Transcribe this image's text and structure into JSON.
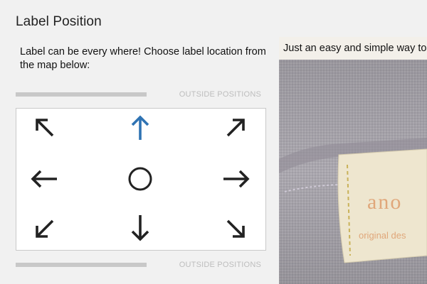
{
  "title": "Label Position",
  "description": "Label can be every where! Choose label location from the map below:",
  "outside_top": "OUTSIDE POSITIONS",
  "outside_bottom": "OUTSIDE POSITIONS",
  "positions": [
    {
      "name": "top-left",
      "icon": "arrow-up-left-icon",
      "selected": false
    },
    {
      "name": "top",
      "icon": "arrow-up-icon",
      "selected": true
    },
    {
      "name": "top-right",
      "icon": "arrow-up-right-icon",
      "selected": false
    },
    {
      "name": "left",
      "icon": "arrow-left-icon",
      "selected": false
    },
    {
      "name": "center",
      "icon": "circle-icon",
      "selected": false
    },
    {
      "name": "right",
      "icon": "arrow-right-icon",
      "selected": false
    },
    {
      "name": "bottom-left",
      "icon": "arrow-down-left-icon",
      "selected": false
    },
    {
      "name": "bottom",
      "icon": "arrow-down-icon",
      "selected": false
    },
    {
      "name": "bottom-right",
      "icon": "arrow-down-right-icon",
      "selected": false
    }
  ],
  "colors": {
    "selected": "#2f73b3",
    "default": "#222222"
  },
  "preview": {
    "caption": "Just an easy and simple way to",
    "label_brand": "ano",
    "label_sub": "original des"
  }
}
